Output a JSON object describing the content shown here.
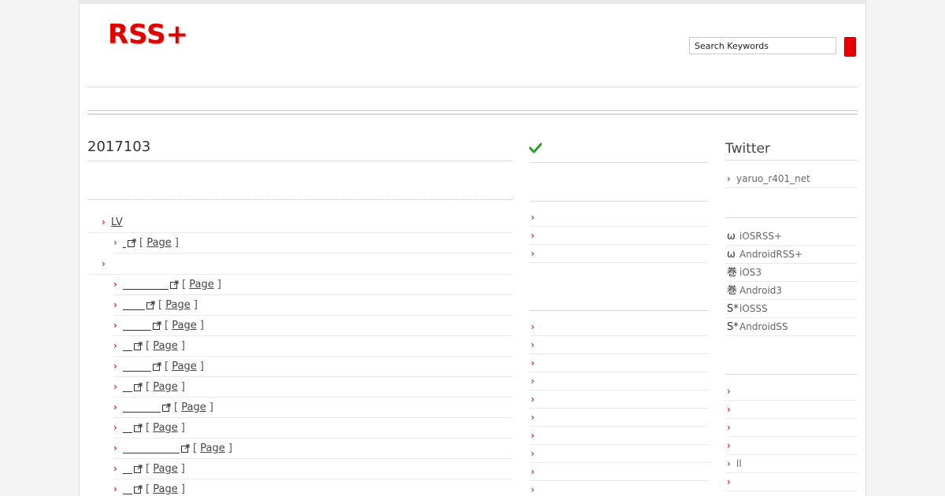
{
  "header": {
    "logo": "RSS+",
    "search_placeholder": "Search Keywords"
  },
  "main": {
    "title": "2017103",
    "category": "LV",
    "first_child_page": "Page",
    "items": [
      {
        "page": "Page"
      },
      {
        "page": "Page"
      },
      {
        "page": "Page"
      },
      {
        "page": "Page"
      },
      {
        "page": "Page"
      },
      {
        "page": "Page"
      },
      {
        "page": "Page"
      },
      {
        "page": "Page"
      },
      {
        "page": "Page"
      },
      {
        "page": "Page"
      },
      {
        "page": "Page"
      }
    ]
  },
  "middle": {
    "check_icon": "checkmark-icon",
    "accent_color": "#2e9d2e"
  },
  "sidebar": {
    "title": "Twitter",
    "twitter_account": "yaruo_r401_net",
    "apps": [
      {
        "glyph": "ω",
        "label": "iOSRSS+"
      },
      {
        "glyph": "ω",
        "label": "AndroidRSS+"
      },
      {
        "glyph": "巻",
        "label": "iOS3"
      },
      {
        "glyph": "巻",
        "label": "Android3"
      },
      {
        "glyph": "S*",
        "label": "iOSSS"
      },
      {
        "glyph": "S*",
        "label": "AndroidSS"
      }
    ],
    "bottom_item_label": "ll"
  },
  "colors": {
    "brand": "#e00000",
    "arrow": "#d00000"
  }
}
